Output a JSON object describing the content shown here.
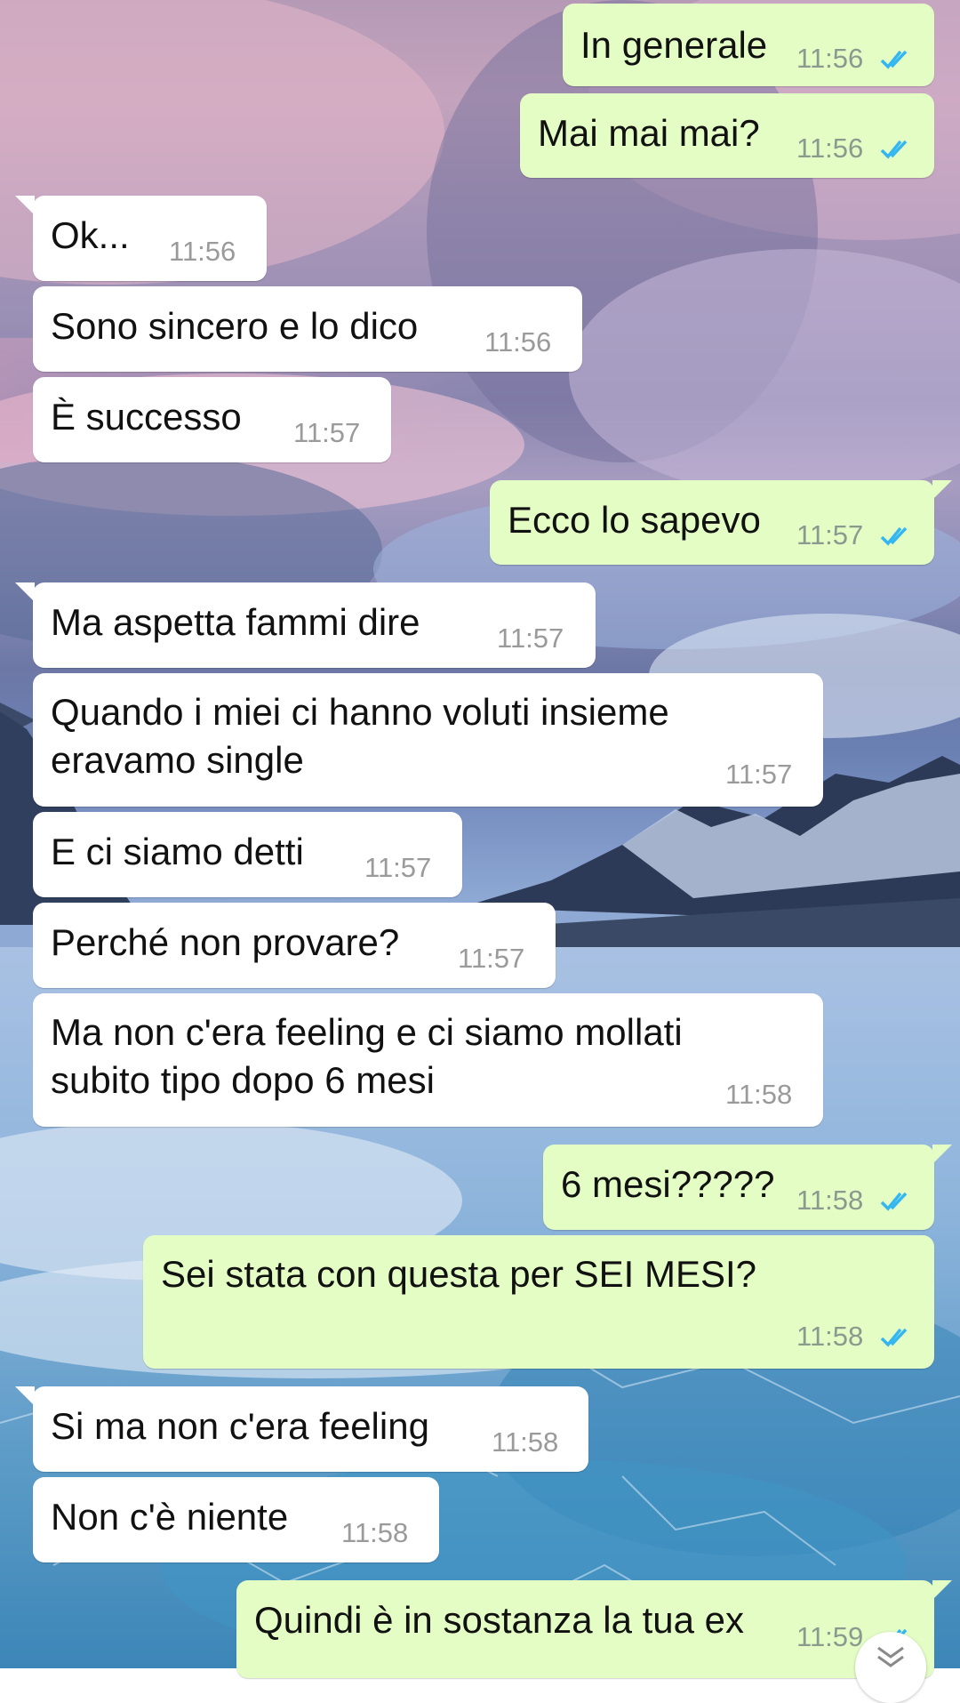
{
  "messages": [
    {
      "dir": "out",
      "text": "In generale",
      "time": "11:56",
      "ticks": true
    },
    {
      "dir": "out",
      "text": "Mai mai mai?",
      "time": "11:56",
      "ticks": true
    },
    {
      "dir": "in",
      "text": "Ok...",
      "time": "11:56"
    },
    {
      "dir": "in",
      "text": "Sono sincero e lo dico",
      "time": "11:56"
    },
    {
      "dir": "in",
      "text": "È successo",
      "time": "11:57"
    },
    {
      "dir": "out",
      "text": "Ecco lo sapevo",
      "time": "11:57",
      "ticks": true
    },
    {
      "dir": "in",
      "text": "Ma aspetta fammi dire",
      "time": "11:57"
    },
    {
      "dir": "in",
      "text": "Quando i miei ci hanno voluti insieme\neravamo single",
      "time": "11:57"
    },
    {
      "dir": "in",
      "text": "E ci siamo detti",
      "time": "11:57"
    },
    {
      "dir": "in",
      "text": "Perché non provare?",
      "time": "11:57"
    },
    {
      "dir": "in",
      "text": "Ma non c'era feeling e ci siamo mollati\nsubito tipo dopo 6 mesi",
      "time": "11:58"
    },
    {
      "dir": "out",
      "text": "6 mesi?????",
      "time": "11:58",
      "ticks": true
    },
    {
      "dir": "out",
      "text": "Sei stata con questa per SEI MESI?",
      "time": "11:58",
      "ticks": true
    },
    {
      "dir": "in",
      "text": "Si ma non c'era feeling",
      "time": "11:58"
    },
    {
      "dir": "in",
      "text": "Non c'è niente",
      "time": "11:58"
    },
    {
      "dir": "out",
      "text": "Quindi è in sostanza la tua ex",
      "time": "11:59",
      "ticks": true
    }
  ],
  "colors": {
    "incoming_bubble": "#ffffff",
    "outgoing_bubble": "#e3fdc5",
    "read_ticks": "#34b7f1",
    "time_text": "#8a9a8e"
  },
  "icons": {
    "read_receipt": "double-check-icon",
    "scroll_down": "chevron-double-down-icon"
  }
}
